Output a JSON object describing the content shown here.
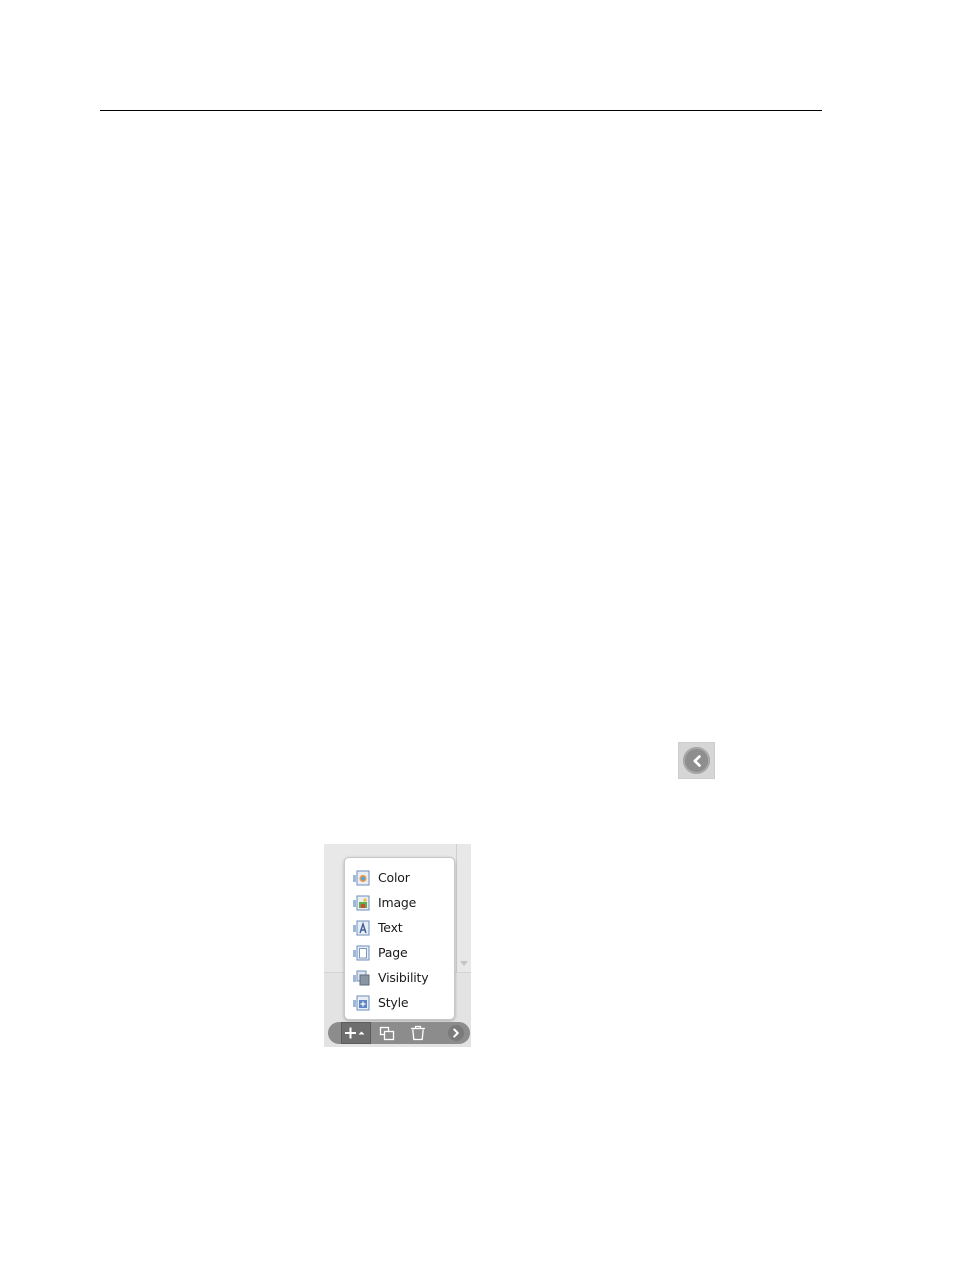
{
  "menu": {
    "items": [
      {
        "label": "Color",
        "icon": "color-layer-icon"
      },
      {
        "label": "Image",
        "icon": "image-layer-icon"
      },
      {
        "label": "Text",
        "icon": "text-layer-icon"
      },
      {
        "label": "Page",
        "icon": "page-layer-icon"
      },
      {
        "label": "Visibility",
        "icon": "visibility-layer-icon"
      },
      {
        "label": "Style",
        "icon": "style-layer-icon"
      }
    ]
  },
  "toolbar": {
    "buttons": [
      "add-icon",
      "duplicate-icon",
      "delete-icon",
      "next-icon"
    ]
  },
  "collapse_button": {
    "icon": "chevron-left-icon"
  }
}
